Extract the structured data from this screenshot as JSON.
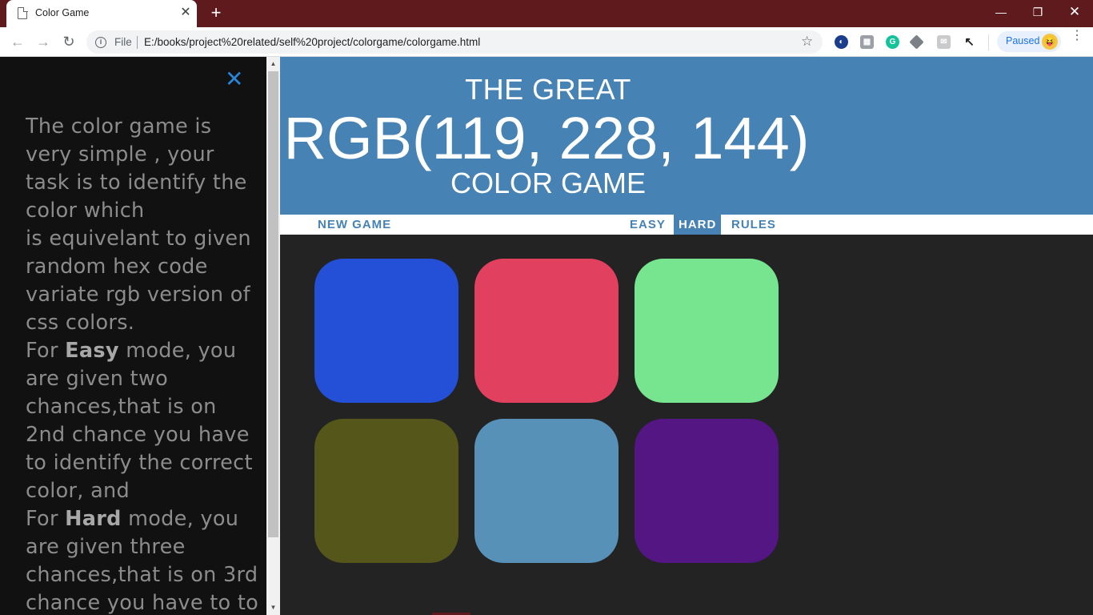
{
  "browser": {
    "tab_title": "Color Game",
    "tab_close": "✕",
    "new_tab": "+",
    "window_controls": {
      "minimize": "—",
      "maximize": "❐",
      "close": "✕"
    },
    "back": "←",
    "forward": "→",
    "reload": "↻",
    "info_glyph": "i",
    "file_label": "File",
    "url": "E:/books/project%20related/self%20project/colorgame/colorgame.html",
    "bookmark_star": "☆",
    "extensions": [
      "edge-icon",
      "gamepad-icon",
      "grammarly-icon",
      "layers-icon",
      "inbox-icon",
      "cursor-icon"
    ],
    "extension_glyphs": {
      "ext1": "◐",
      "ext2": "▦",
      "ext3": "G",
      "ext5": "✉",
      "ext6": "↖"
    },
    "profile_status": "Paused",
    "avatar_glyph": "😝",
    "menu": "⋮"
  },
  "header": {
    "line1": "THE GREAT",
    "rgb_display": "RGB(119, 228, 144)",
    "line2": "COLOR GAME",
    "background": "#4682b4"
  },
  "stripe": {
    "new_game": "NEW GAME",
    "easy": "EASY",
    "hard": "HARD",
    "rules": "RULES",
    "selected_mode": "HARD"
  },
  "squares": [
    {
      "color": "#2350d6"
    },
    {
      "color": "#e1405f"
    },
    {
      "color": "#77e48f"
    },
    {
      "color": "#55571a"
    },
    {
      "color": "#5891b8"
    },
    {
      "color": "#531682"
    }
  ],
  "sidebar": {
    "close": "✕",
    "p1": "The color game is very simple  , your task is to identify the color which",
    "p2": "is equivelant to given random hex code variate rgb version of css colors.",
    "easy_prefix": "For ",
    "easy_bold": "Easy",
    "easy_rest": " mode, you are given two chances,that is on 2nd chance you have to identify the correct color, and",
    "hard_prefix": "For ",
    "hard_bold": "Hard",
    "hard_rest": " mode, you are given three chances,that is on 3rd chance you have to to"
  }
}
